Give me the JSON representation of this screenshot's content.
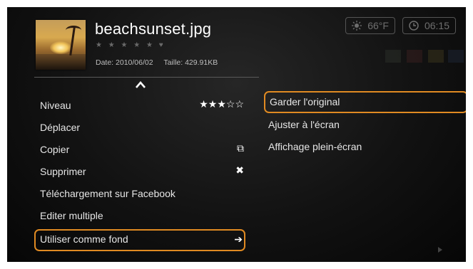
{
  "file": {
    "name": "beachsunset.jpg",
    "rating_label": "★ ★ ★ ★ ★ ♥",
    "date_label": "Date: 2010/06/02",
    "size_label": "Taille: 429.91KB"
  },
  "status": {
    "temperature": "66°F",
    "time": "06:15"
  },
  "menu": {
    "items": [
      {
        "label": "Niveau",
        "tail": "★★★☆☆"
      },
      {
        "label": "Déplacer",
        "tail": ""
      },
      {
        "label": "Copier",
        "tail": "⧉"
      },
      {
        "label": "Supprimer",
        "tail": "✖"
      },
      {
        "label": "Téléchargement sur Facebook",
        "tail": ""
      },
      {
        "label": "Editer multiple",
        "tail": ""
      },
      {
        "label": "Utiliser comme fond",
        "tail": "➔"
      }
    ]
  },
  "submenu": {
    "items": [
      {
        "label": "Garder l'original"
      },
      {
        "label": "Ajuster à l'écran"
      },
      {
        "label": "Affichage plein-écran"
      }
    ]
  },
  "colors": {
    "accent": "#e08a22",
    "background": "#0d0d0d",
    "text": "#e6e6e6"
  }
}
